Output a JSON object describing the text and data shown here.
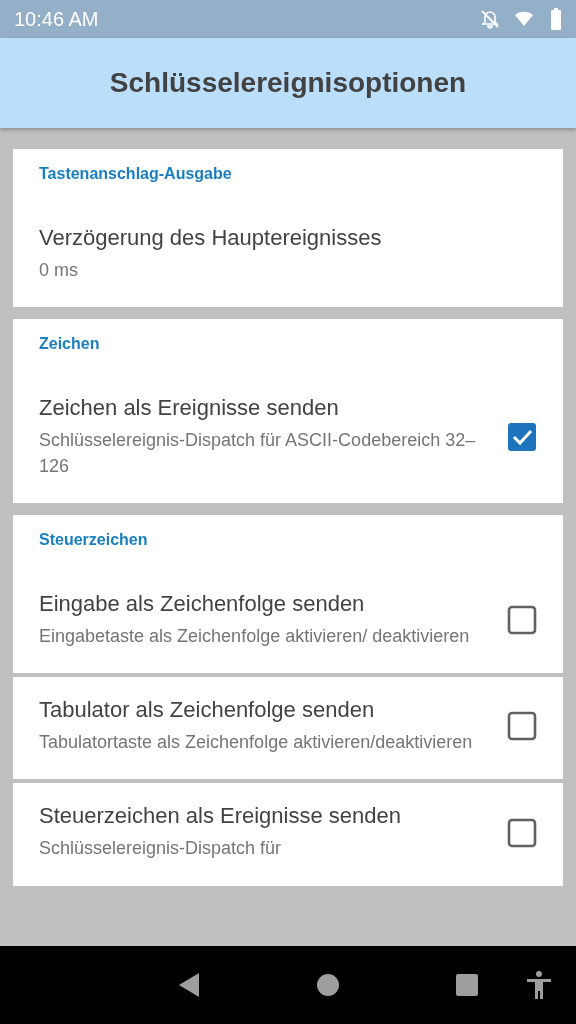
{
  "status_bar": {
    "time": "10:46 AM"
  },
  "header": {
    "title": "Schlüsselereignisoptionen"
  },
  "sections": [
    {
      "header": "Tastenanschlag-Ausgabe",
      "items": [
        {
          "kind": "value",
          "title": "Verzögerung des Hauptereignisses",
          "subtitle": "0 ms"
        }
      ]
    },
    {
      "header": "Zeichen",
      "items": [
        {
          "kind": "checkbox",
          "title": "Zeichen als Ereignisse senden",
          "subtitle": "Schlüsselereignis-Dispatch für ASCII-Codebereich 32–126",
          "checked": true
        }
      ]
    },
    {
      "header": "Steuerzeichen",
      "items": [
        {
          "kind": "checkbox",
          "title": "Eingabe als Zeichenfolge senden",
          "subtitle": "Eingabetaste als Zeichenfolge aktivieren/ deaktivieren",
          "checked": false
        },
        {
          "kind": "checkbox",
          "title": "Tabulator als Zeichenfolge senden",
          "subtitle": "Tabulatortaste als Zeichenfolge aktivieren/deaktivieren",
          "checked": false
        },
        {
          "kind": "checkbox",
          "title": "Steuerzeichen als Ereignisse senden",
          "subtitle": "Schlüsselereignis-Dispatch für",
          "checked": false
        }
      ]
    }
  ]
}
